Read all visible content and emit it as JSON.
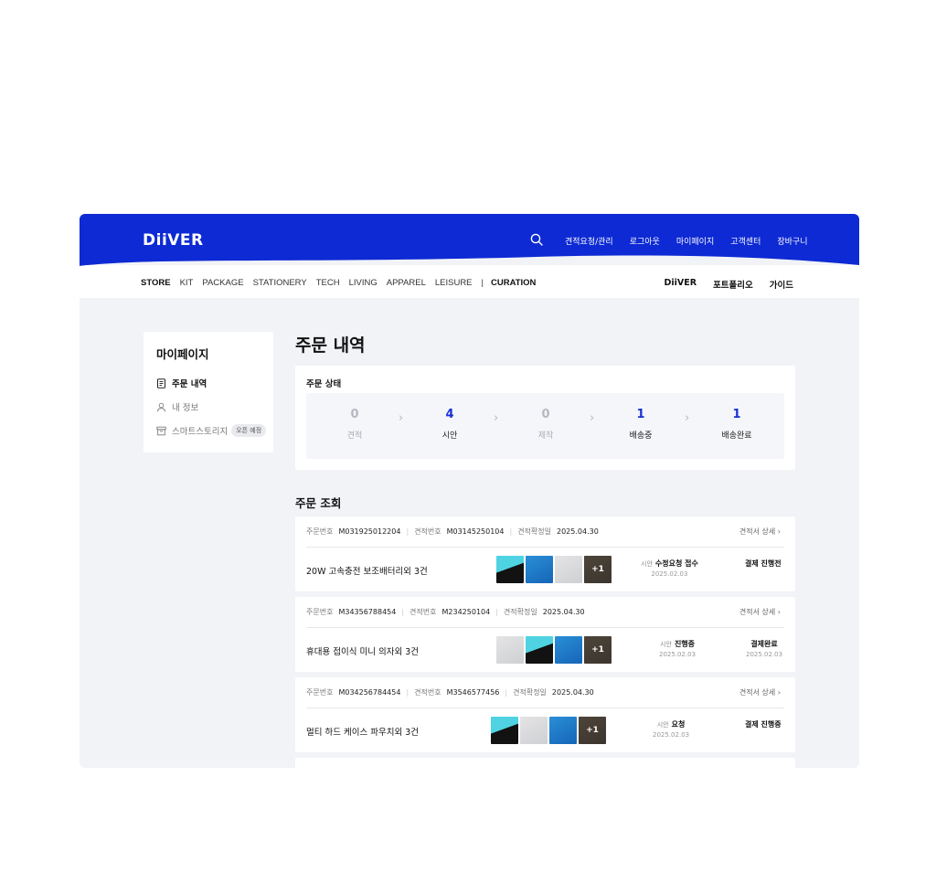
{
  "brand": {
    "logo": "DiiVER",
    "accent": "#0d2ad4"
  },
  "topnav": [
    "견적요청/관리",
    "로그아웃",
    "마이페이지",
    "고객센터",
    "장바구니"
  ],
  "categories": [
    "STORE",
    "KIT",
    "PACKAGE",
    "STATIONERY",
    "TECH",
    "LIVING",
    "APPAREL",
    "LEISURE",
    "|",
    "CURATION"
  ],
  "rightnav": [
    "DiiVER",
    "포트폴리오",
    "가이드"
  ],
  "sidebar": {
    "title": "마이페이지",
    "items": [
      {
        "label": "주문 내역",
        "icon": "document-icon"
      },
      {
        "label": "내 정보",
        "icon": "user-icon"
      },
      {
        "label": "스마트스토리지",
        "icon": "archive-icon",
        "badge": "오픈 예정"
      }
    ]
  },
  "page_title": "주문 내역",
  "status": {
    "title": "주문 상태",
    "steps": [
      {
        "count": "0",
        "label": "견적"
      },
      {
        "count": "4",
        "label": "시안"
      },
      {
        "count": "0",
        "label": "제작"
      },
      {
        "count": "1",
        "label": "배송중"
      },
      {
        "count": "1",
        "label": "배송완료"
      }
    ]
  },
  "orders_title": "주문 조회",
  "orders": [
    {
      "order_label": "주문번호",
      "order_no": "M031925012204",
      "quote_label": "견적번호",
      "quote_no": "M03145250104",
      "confirm_label": "견적확정일",
      "confirm_date": "2025.04.30",
      "detail": "견적서 상세",
      "product": "20W 고속충전 보조배터리외 3건",
      "more": "+1",
      "stage_key": "시안",
      "stage": "수정요청 접수",
      "stage_date": "2025.02.03",
      "payment": "결제 진행전",
      "payment_date": ""
    },
    {
      "order_label": "주문번호",
      "order_no": "M34356788454",
      "quote_label": "견적번호",
      "quote_no": "M234250104",
      "confirm_label": "견적확정일",
      "confirm_date": "2025.04.30",
      "detail": "견적서 상세",
      "product": "휴대용 접이식 미니 의자외 3건",
      "more": "+1",
      "stage_key": "시안",
      "stage": "진행중",
      "stage_date": "2025.02.03",
      "payment": "결제완료",
      "payment_date": "2025.02.03"
    },
    {
      "order_label": "주문번호",
      "order_no": "M034256784454",
      "quote_label": "견적번호",
      "quote_no": "M3546577456",
      "confirm_label": "견적확정일",
      "confirm_date": "2025.04.30",
      "detail": "견적서 상세",
      "product": "멀티 하드 케이스 파우치외 3건",
      "more": "+1",
      "stage_key": "시안",
      "stage": "요청",
      "stage_date": "2025.02.03",
      "payment": "결제 진행중",
      "payment_date": ""
    }
  ]
}
